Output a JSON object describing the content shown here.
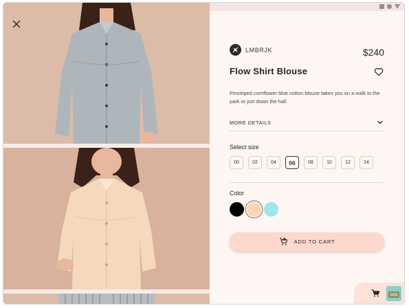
{
  "product": {
    "brand": "LMBRJK",
    "price": "$240",
    "title": "Flow Shirt Blouse",
    "description": "Pinstriped cornflower blue cotton blouse takes you on a walk to the park or just down the hall.",
    "details_label": "MORE DETAILS"
  },
  "size": {
    "title": "Select size",
    "options": [
      "00",
      "02",
      "04",
      "06",
      "08",
      "10",
      "12",
      "14"
    ],
    "selected": "06"
  },
  "color": {
    "title": "Color",
    "options": [
      {
        "name": "black",
        "hex": "#000000"
      },
      {
        "name": "peach",
        "hex": "#fbd5b4",
        "selected": true
      },
      {
        "name": "aqua",
        "hex": "#9ee6ea"
      }
    ]
  },
  "cart": {
    "button_label": "ADD TO CART"
  },
  "icons": {
    "close": "close-icon",
    "favorite": "heart-outline-icon",
    "expand": "chevron-down-icon",
    "add_cart": "add-shopping-cart-icon",
    "cart": "shopping-cart-icon"
  },
  "colors": {
    "panel_bg": "#fdf6f3",
    "accent": "#fcd8cd",
    "chip_border": "#e9c8c0"
  }
}
